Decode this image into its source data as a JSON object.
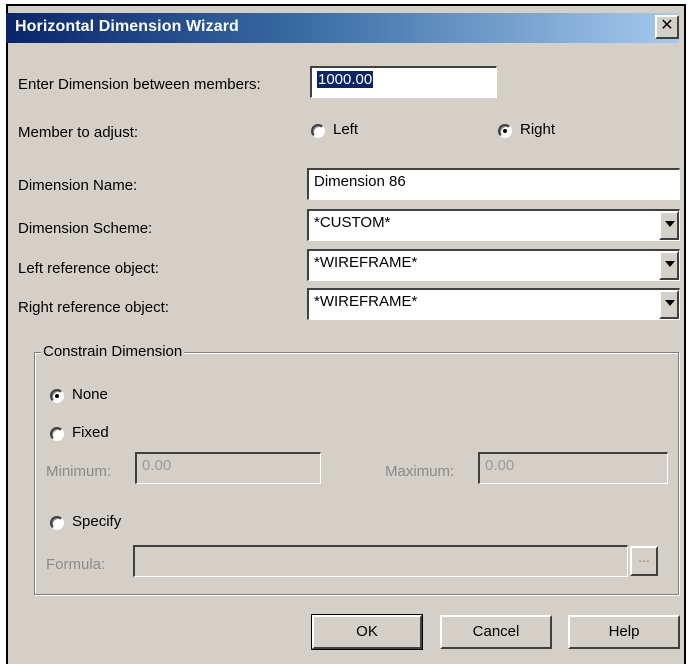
{
  "window": {
    "title": "Horizontal Dimension Wizard",
    "close_glyph": "✕"
  },
  "dimension": {
    "label": "Enter Dimension between members:",
    "value": "1000.00"
  },
  "member": {
    "label": "Member to adjust:",
    "options": [
      "Left",
      "Right"
    ],
    "selected": "Right"
  },
  "dimension_name": {
    "label": "Dimension Name:",
    "value": "Dimension 86"
  },
  "dimension_scheme": {
    "label": "Dimension Scheme:",
    "value": "*CUSTOM*"
  },
  "left_reference": {
    "label": "Left reference object:",
    "value": "*WIREFRAME*"
  },
  "right_reference": {
    "label": "Right reference object:",
    "value": "*WIREFRAME*"
  },
  "constrain": {
    "legend": "Constrain Dimension",
    "options": [
      "None",
      "Fixed",
      "Specify"
    ],
    "selected": "None",
    "minimum_label": "Minimum:",
    "minimum_value": "0.00",
    "maximum_label": "Maximum:",
    "maximum_value": "0.00",
    "formula_label": "Formula:",
    "formula_value": "",
    "browse_label": "..."
  },
  "buttons": {
    "ok": "OK",
    "cancel": "Cancel",
    "help": "Help"
  },
  "colors": {
    "title_bar": "#0a246a",
    "dialog_bg": "#d4d0c8",
    "selection": "#0a246a"
  }
}
